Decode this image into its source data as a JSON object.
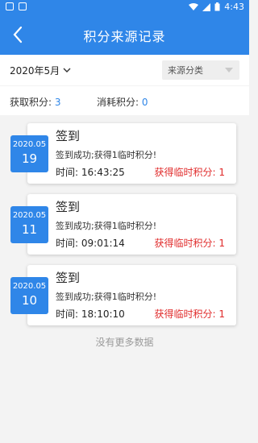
{
  "status_bar": {
    "time": "4:43"
  },
  "nav": {
    "title": "积分来源记录"
  },
  "filter": {
    "month": "2020年5月",
    "source_label": "来源分类"
  },
  "stats": {
    "earned_label": "获取积分:",
    "earned_value": "3",
    "spent_label": "消耗积分:",
    "spent_value": "0"
  },
  "records": [
    {
      "year_month": "2020.05",
      "day": "19",
      "title": "签到",
      "desc": "签到成功;获得1临时积分!",
      "time_label": "时间:",
      "time": "16:43:25",
      "points": "获得临时积分: 1"
    },
    {
      "year_month": "2020.05",
      "day": "11",
      "title": "签到",
      "desc": "签到成功;获得1临时积分!",
      "time_label": "时间:",
      "time": "09:01:14",
      "points": "获得临时积分: 1"
    },
    {
      "year_month": "2020.05",
      "day": "10",
      "title": "签到",
      "desc": "签到成功;获得1临时积分!",
      "time_label": "时间:",
      "time": "18:10:10",
      "points": "获得临时积分: 1"
    }
  ],
  "footer": {
    "no_more": "没有更多数据"
  },
  "colors": {
    "primary": "#2f86e8",
    "points_red": "#e02a2a"
  },
  "icons": {
    "back": "chevron-left-icon",
    "month_dropdown": "chevron-down-icon",
    "source_dropdown": "triangle-down-icon"
  }
}
